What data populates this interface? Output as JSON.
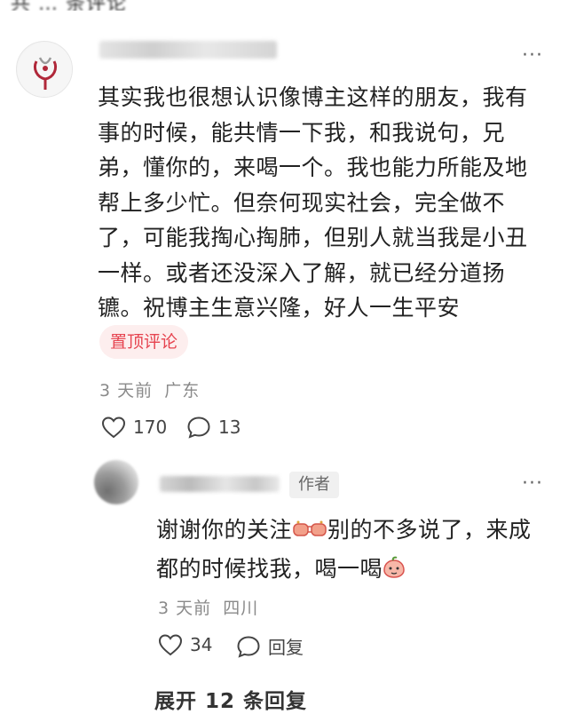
{
  "top": {
    "partial_text": "共 … 条评论"
  },
  "main_comment": {
    "username": "",
    "more_icon": "more-dots-icon",
    "text": "其实我也很想认识像博主这样的朋友，我有事的时候，能共情一下我，和我说句，兄弟，懂你的，来喝一个。我也能力所能及地帮上多少忙。但奈何现实社会，完全做不了，可能我掏心掏肺，但别人就当我是小丑一样。或者还没深入了解，就已经分道扬镳。祝博主生意兴隆，好人一生平安",
    "pin_label": "置顶评论",
    "time": "3 天前",
    "location": "广东",
    "likes": "170",
    "replies": "13",
    "like_icon": "heart-outline-icon",
    "reply_icon": "chat-bubble-icon"
  },
  "reply_comment": {
    "username": "",
    "author_tag": "作者",
    "more_icon": "more-dots-icon",
    "text_part1": "谢谢你的关注",
    "emoji1": "fist-bump-emoji",
    "text_part2": "别的不多说了，来成都的时候找我，喝一喝",
    "emoji2": "peach-face-emoji",
    "time": "3 天前",
    "location": "四川",
    "likes": "34",
    "reply_label": "回复",
    "like_icon": "heart-outline-icon",
    "reply_icon": "chat-bubble-icon"
  },
  "expand_label": "展开 12 条回复",
  "colors": {
    "accent_red": "#e6434f",
    "pin_bg": "#fdeeee",
    "meta_gray": "#8a8a8a",
    "author_tag_bg": "#f0f0f0"
  }
}
